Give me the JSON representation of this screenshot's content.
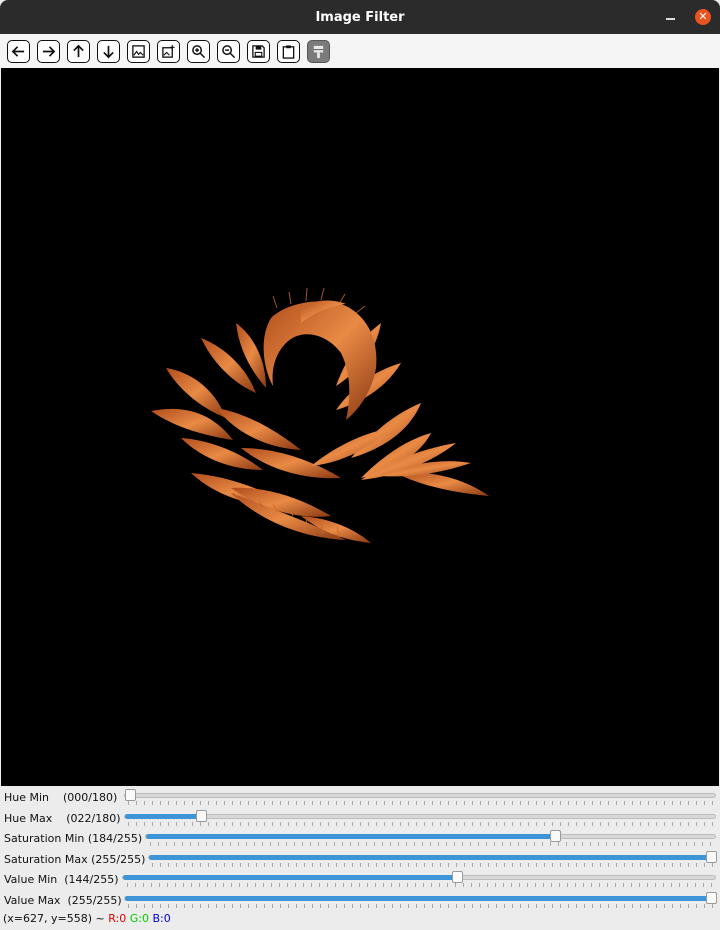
{
  "window": {
    "title": "Image Filter"
  },
  "toolbar": {
    "tools": [
      "back-arrow",
      "forward-arrow",
      "up-arrow",
      "down-arrow",
      "image",
      "image-add",
      "zoom-in",
      "zoom-out",
      "save",
      "clipboard",
      "paint-brush"
    ]
  },
  "trackbars": [
    {
      "label": "Hue Min    (000/180)",
      "value": 0,
      "max": 180
    },
    {
      "label": "Hue Max    (022/180)",
      "value": 22,
      "max": 180
    },
    {
      "label": "Saturation Min (184/255)",
      "value": 184,
      "max": 255
    },
    {
      "label": "Saturation Max (255/255)",
      "value": 255,
      "max": 255
    },
    {
      "label": "Value Min  (144/255)",
      "value": 144,
      "max": 255
    },
    {
      "label": "Value Max  (255/255)",
      "value": 255,
      "max": 255
    }
  ],
  "status": {
    "coords": "(x=627, y=558) ~ ",
    "r": "R:0",
    "g": "G:0",
    "b": "B:0"
  },
  "colors": {
    "accent": "#3d95d8",
    "close": "#e95420",
    "flower": "#e07a3c"
  }
}
